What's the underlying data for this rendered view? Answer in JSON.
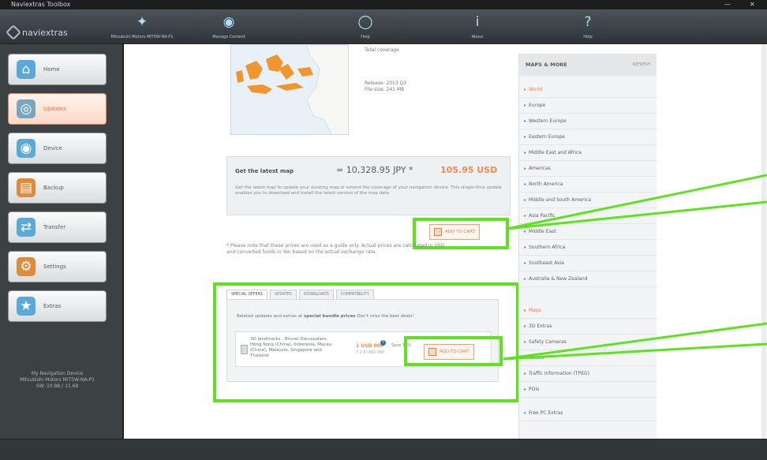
{
  "window": {
    "title": "Naviextras Toolbox"
  },
  "topbar": {
    "logo_text": "naviextras",
    "buttons": [
      {
        "label": "Mitsubishi Motors MIT5W-NA-P1",
        "icon": "car-icon"
      },
      {
        "label": "Manage Content",
        "icon": "group-icon"
      },
      {
        "label": "Help",
        "icon": "globe-icon"
      },
      {
        "label": "About",
        "icon": "info-icon"
      },
      {
        "label": "Help",
        "icon": "question-icon"
      }
    ]
  },
  "sidebar": {
    "items": [
      {
        "label": "Home",
        "icon": "home-icon",
        "active": false,
        "color": "#5aa9d8"
      },
      {
        "label": "Updates",
        "icon": "disc-icon",
        "active": true,
        "color": "#7aa6c2"
      },
      {
        "label": "Device",
        "icon": "globe-icon",
        "active": false,
        "color": "#5aa9d8"
      },
      {
        "label": "Backup",
        "icon": "backup-icon",
        "active": false,
        "color": "#e08b3a"
      },
      {
        "label": "Transfer",
        "icon": "transfer-icon",
        "active": false,
        "color": "#5aa9d8"
      },
      {
        "label": "Settings",
        "icon": "gear-icon",
        "active": false,
        "color": "#e08b3a"
      },
      {
        "label": "Extras",
        "icon": "star-icon",
        "active": false,
        "color": "#5aa9d8"
      }
    ],
    "device_info": "My Navigation Device\nMitsubishi Motors MIT5W-NA-P1\nSW: 10.88 / 11.68"
  },
  "main": {
    "map_info": {
      "coverage": "Total coverage",
      "release": "Release: 2013 Q3",
      "size": "File size: 241 MB"
    },
    "buy": {
      "title": "Get the latest map",
      "price_jpy": "= 10,328.95 JPY *",
      "price_usd": "105.95 USD",
      "description": "Get the latest map to update your existing map or extend the coverage of your navigation device. This single-time update enables you to download and install the latest version of the map data.",
      "add_to_cart": "ADD TO CART"
    },
    "note": "* Please note that these prices are used as a guide only. Actual prices are calculated in USD and converted funds in Yen based on the actual exchange rate.",
    "offers": {
      "tabs": [
        "SPECIAL OFFERS",
        "UPDATES",
        "DOWNLOADS",
        "COMPATIBILITY"
      ],
      "intro_prefix": "Related updates and extras at ",
      "intro_bold": "special bundle prices",
      "intro_suffix": " Don't miss the best deals!",
      "card_desc": "3D landmarks - Brunei Darussalam, Hong Kong (China), Indonesia, Macau (China), Malaysia, Singapore and Thailand",
      "price": "1 USD 000",
      "old_price": "7 2 6 USD 000",
      "save": "Save 10%",
      "add_to_cart": "ADD TO CART"
    }
  },
  "maps_more": {
    "title": "MAPS & MORE",
    "link": "REFRESH",
    "items": [
      {
        "label": "World",
        "selected": true
      },
      {
        "label": "Europe",
        "selected": false
      },
      {
        "label": "Western Europe",
        "selected": false
      },
      {
        "label": "Eastern Europe",
        "selected": false
      },
      {
        "label": "Middle East and Africa",
        "selected": false
      },
      {
        "label": "Americas",
        "selected": false
      },
      {
        "label": "North America",
        "selected": false
      },
      {
        "label": "Middle and South America",
        "selected": false
      },
      {
        "label": "Asia Pacific",
        "selected": false
      },
      {
        "label": "Middle East",
        "selected": false
      },
      {
        "label": "Southern Africa",
        "selected": false
      },
      {
        "label": "Southeast Asia",
        "selected": false
      },
      {
        "label": "Australia & New Zealand",
        "selected": false
      },
      {
        "label": "Maps",
        "selected": true
      },
      {
        "label": "3D Extras",
        "selected": false
      },
      {
        "label": "Safety Cameras",
        "selected": false
      },
      {
        "label": "Voices",
        "selected": false
      },
      {
        "label": "Traffic Information (TPEG)",
        "selected": false
      },
      {
        "label": "POIs",
        "selected": false
      },
      {
        "label": "Free PC Extras",
        "selected": false
      }
    ]
  },
  "colors": {
    "highlight": "#5ee21f",
    "accent": "#ee7b3e"
  }
}
